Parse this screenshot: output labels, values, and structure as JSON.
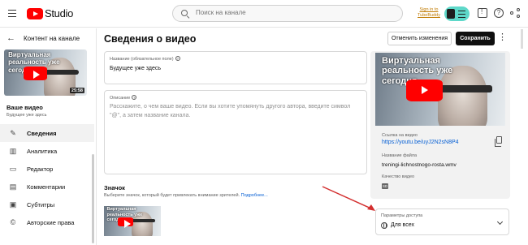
{
  "header": {
    "logo_text": "Studio",
    "search_placeholder": "Поиск на канале",
    "extension_link": "Sign in to TubeBuddy",
    "help_glyph": "?"
  },
  "sidebar": {
    "back_title": "Контент на канале",
    "video_heading": "Ваше видео",
    "video_subtitle": "Будущее уже здесь",
    "thumbnail_caption": "Виртуальная реальность уже сегодня",
    "duration": "25:58",
    "items": [
      {
        "label": "Сведения",
        "icon": "pencil-icon",
        "active": true
      },
      {
        "label": "Аналитика",
        "icon": "analytics-icon",
        "active": false
      },
      {
        "label": "Редактор",
        "icon": "editor-icon",
        "active": false
      },
      {
        "label": "Комментарии",
        "icon": "comments-icon",
        "active": false
      },
      {
        "label": "Субтитры",
        "icon": "subtitles-icon",
        "active": false
      },
      {
        "label": "Авторские права",
        "icon": "copyright-icon",
        "active": false
      }
    ]
  },
  "main": {
    "page_title": "Сведения о видео",
    "undo_label": "Отменить изменения",
    "save_label": "Сохранить",
    "title_field": {
      "label": "Название (обязательное поле)",
      "value": "Будущее уже здесь"
    },
    "description_field": {
      "label": "Описание",
      "placeholder": "Расскажите, о чем ваше видео. Если вы хотите упомянуть другого автора, введите символ \"@\", а затем название канала."
    },
    "thumbnail_section": {
      "title": "Значок",
      "subtitle": "Выберите значок, который будет привлекать внимание зрителей.",
      "more_link": "Подробнее...",
      "option_caption": "Виртуальная реальность уже сегодня"
    }
  },
  "video_card": {
    "thumbnail_caption": "Виртуальная реальность уже сегодня",
    "link_label": "Ссылка на видео",
    "link_value": "https://youtu.be/uyJ2N2sN8P4",
    "filename_label": "Название файла",
    "filename_value": "treningi-lichnostnogo-rosta.wmv",
    "quality_label": "Качество видео",
    "quality_badge": "SD"
  },
  "visibility": {
    "label": "Параметры доступа",
    "value": "Для всех"
  },
  "colors": {
    "brand_red": "#ff0000",
    "link_blue": "#065fd4",
    "extension_teal": "#5ed8c9",
    "arrow_red": "#d32f2f"
  }
}
